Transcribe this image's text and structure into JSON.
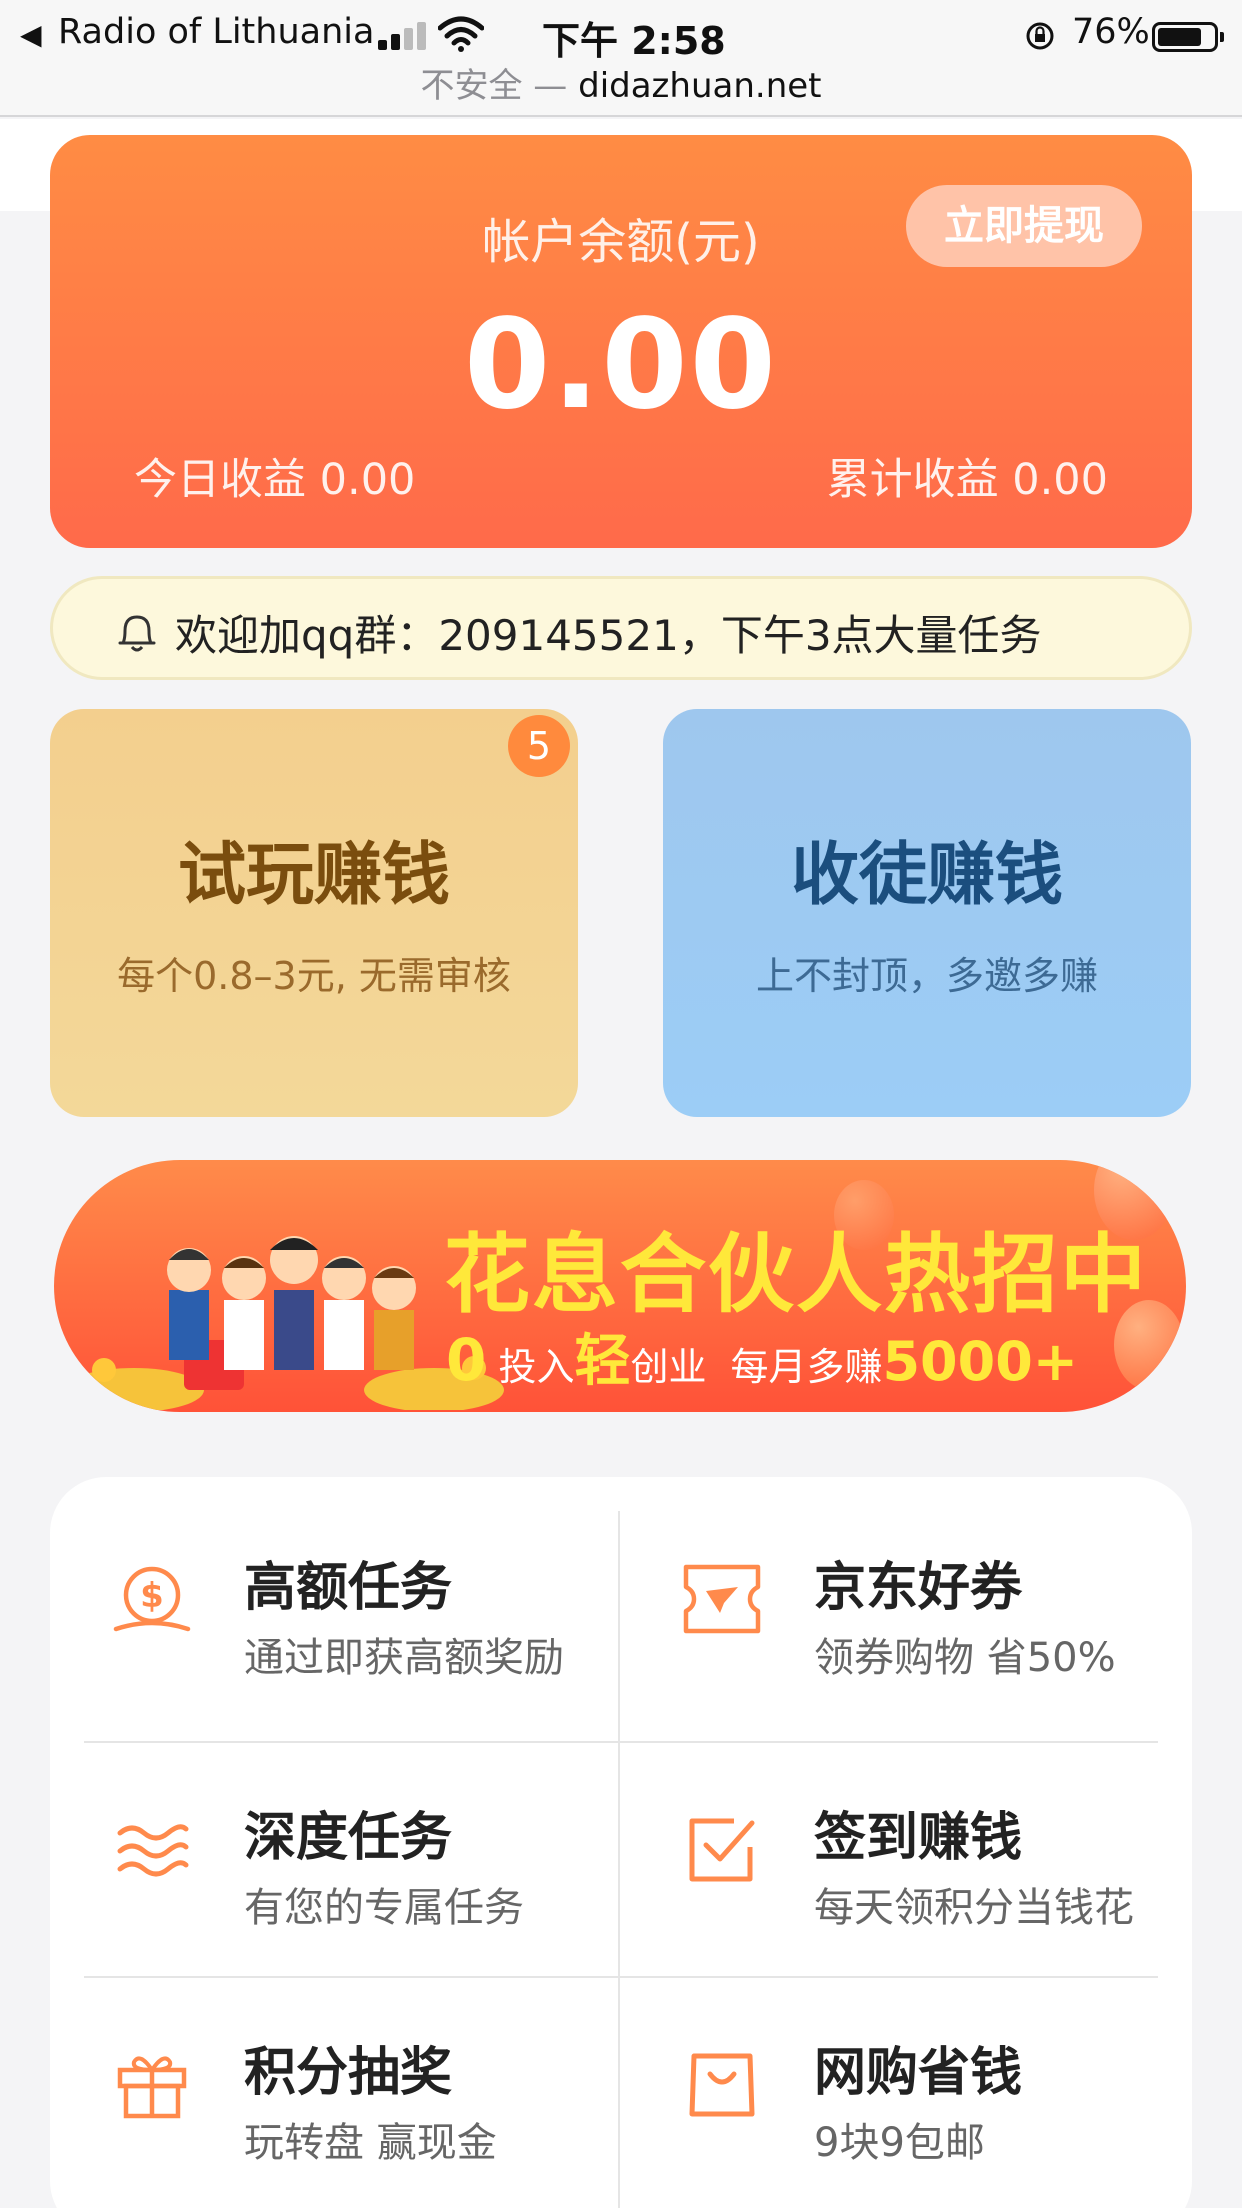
{
  "status_bar": {
    "back_glyph": "◀",
    "carrier": "Radio of Lithuania",
    "time": "下午 2:58",
    "battery": "76%",
    "url_insecure": "不安全 —",
    "url_host": "didazhuan.net"
  },
  "balance": {
    "label": "帐户余额(元)",
    "amount": "0.00",
    "withdraw_label": "立即提现",
    "today_label": "今日收益 0.00",
    "total_label": "累计收益 0.00"
  },
  "notice": {
    "text": "欢迎加qq群：209145521，下午3点大量任务"
  },
  "cards": {
    "trial": {
      "title": "试玩赚钱",
      "subtitle": "每个0.8–3元, 无需审核",
      "badge": "5"
    },
    "invite": {
      "title": "收徒赚钱",
      "subtitle": "上不封顶，多邀多赚"
    }
  },
  "banner": {
    "title": "花息合伙人热招中",
    "zero": "0",
    "invest": " 投入",
    "light": "轻",
    "startup": "创业",
    "monthly": "每月多赚",
    "amount": "5000+"
  },
  "grid": {
    "items": [
      {
        "title": "高额任务",
        "subtitle": "通过即获高额奖励",
        "icon": "dollar-coin-icon"
      },
      {
        "title": "京东好券",
        "subtitle": "领券购物 省50%",
        "icon": "coupon-icon"
      },
      {
        "title": "深度任务",
        "subtitle": "有您的专属任务",
        "icon": "waves-icon"
      },
      {
        "title": "签到赚钱",
        "subtitle": "每天领积分当钱花",
        "icon": "checkbox-icon"
      },
      {
        "title": "积分抽奖",
        "subtitle": "玩转盘 赢现金",
        "icon": "gift-icon"
      },
      {
        "title": "网购省钱",
        "subtitle": "9块9包邮",
        "icon": "shopping-bag-icon"
      }
    ]
  },
  "colors": {
    "accent_orange": "#ff7a45",
    "icon_orange": "#ff8a4c",
    "banner_yellow": "#ffe83a"
  }
}
